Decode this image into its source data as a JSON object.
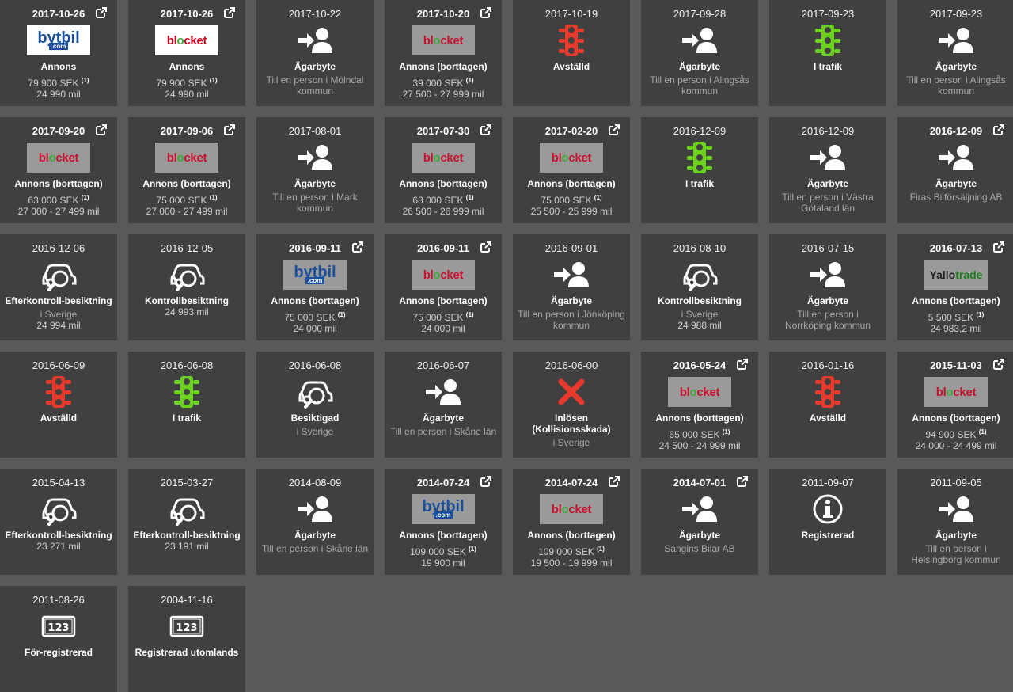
{
  "colors": {
    "page_bg": "#595959",
    "card_bg": "#404040",
    "red": "#e53a2c",
    "green": "#6bd320",
    "x_red": "#e53a2c"
  },
  "events": [
    {
      "date": "2017-10-26",
      "link": true,
      "icon": "bytbil-logo-white",
      "title": "Annons",
      "l1": "79 900 SEK",
      "sup": "(1)",
      "l2": "24 990 mil"
    },
    {
      "date": "2017-10-26",
      "link": true,
      "icon": "blocket-logo-white",
      "title": "Annons",
      "l1": "79 900 SEK",
      "sup": "(1)",
      "l2": "24 990 mil"
    },
    {
      "date": "2017-10-22",
      "link": false,
      "icon": "owner-change-icon",
      "title": "Ägarbyte",
      "sub": "Till en person i Mölndal kommun"
    },
    {
      "date": "2017-10-20",
      "link": true,
      "icon": "blocket-logo-grey",
      "title": "Annons (borttagen)",
      "l1": "39 000 SEK",
      "sup": "(1)",
      "l2": "27 500 - 27 999 mil"
    },
    {
      "date": "2017-10-19",
      "link": false,
      "icon": "traffic-light-red-icon",
      "title": "Avställd"
    },
    {
      "date": "2017-09-28",
      "link": false,
      "icon": "owner-change-icon",
      "title": "Ägarbyte",
      "sub": "Till en person i Alingsås kommun"
    },
    {
      "date": "2017-09-23",
      "link": false,
      "icon": "traffic-light-green-icon",
      "title": "I trafik"
    },
    {
      "date": "2017-09-23",
      "link": false,
      "icon": "owner-change-icon",
      "title": "Ägarbyte",
      "sub": "Till en person i Alingsås kommun"
    },
    {
      "date": "2017-09-20",
      "link": true,
      "icon": "blocket-logo-grey",
      "title": "Annons (borttagen)",
      "l1": "63 000 SEK",
      "sup": "(1)",
      "l2": "27 000 - 27 499 mil"
    },
    {
      "date": "2017-09-06",
      "link": true,
      "icon": "blocket-logo-grey",
      "title": "Annons (borttagen)",
      "l1": "75 000 SEK",
      "sup": "(1)",
      "l2": "27 000 - 27 499 mil"
    },
    {
      "date": "2017-08-01",
      "link": false,
      "icon": "owner-change-icon",
      "title": "Ägarbyte",
      "sub": "Till en person i Mark kommun"
    },
    {
      "date": "2017-07-30",
      "link": true,
      "icon": "blocket-logo-grey",
      "title": "Annons (borttagen)",
      "l1": "68 000 SEK",
      "sup": "(1)",
      "l2": "26 500 - 26 999 mil"
    },
    {
      "date": "2017-02-20",
      "link": true,
      "icon": "blocket-logo-grey",
      "title": "Annons (borttagen)",
      "l1": "75 000 SEK",
      "sup": "(1)",
      "l2": "25 500 - 25 999 mil"
    },
    {
      "date": "2016-12-09",
      "link": false,
      "icon": "traffic-light-green-icon",
      "title": "I trafik"
    },
    {
      "date": "2016-12-09",
      "link": false,
      "icon": "owner-change-icon",
      "title": "Ägarbyte",
      "sub": "Till en person i Västra Götaland län"
    },
    {
      "date": "2016-12-09",
      "link": true,
      "icon": "owner-change-icon",
      "title": "Ägarbyte",
      "sub": "Firas Bilförsäljning AB"
    },
    {
      "date": "2016-12-06",
      "link": false,
      "icon": "car-inspection-icon",
      "title": "Efterkontroll-besiktning",
      "sub": "i Sverige",
      "l2": "24 994 mil"
    },
    {
      "date": "2016-12-05",
      "link": false,
      "icon": "car-inspection-icon",
      "title": "Kontrollbesiktning",
      "l2": "24 993 mil"
    },
    {
      "date": "2016-09-11",
      "link": true,
      "icon": "bytbil-logo-grey",
      "title": "Annons (borttagen)",
      "l1": "75 000 SEK",
      "sup": "(1)",
      "l2": "24 000 mil"
    },
    {
      "date": "2016-09-11",
      "link": true,
      "icon": "blocket-logo-grey",
      "title": "Annons (borttagen)",
      "l1": "75 000 SEK",
      "sup": "(1)",
      "l2": "24 000 mil"
    },
    {
      "date": "2016-09-01",
      "link": false,
      "icon": "owner-change-icon",
      "title": "Ägarbyte",
      "sub": "Till en person i Jönköping kommun"
    },
    {
      "date": "2016-08-10",
      "link": false,
      "icon": "car-inspection-icon",
      "title": "Kontrollbesiktning",
      "sub": "i Sverige",
      "l2": "24 988 mil"
    },
    {
      "date": "2016-07-15",
      "link": false,
      "icon": "owner-change-icon",
      "title": "Ägarbyte",
      "sub": "Till en person i Norrköping kommun"
    },
    {
      "date": "2016-07-13",
      "link": true,
      "icon": "yallotrade-logo",
      "title": "Annons (borttagen)",
      "l1": "5 500 SEK",
      "sup": "(1)",
      "l2": "24 983,2 mil"
    },
    {
      "date": "2016-06-09",
      "link": false,
      "icon": "traffic-light-red-icon",
      "title": "Avställd"
    },
    {
      "date": "2016-06-08",
      "link": false,
      "icon": "traffic-light-green-icon",
      "title": "I trafik"
    },
    {
      "date": "2016-06-08",
      "link": false,
      "icon": "car-inspection-icon",
      "title": "Besiktigad",
      "sub": "i Sverige"
    },
    {
      "date": "2016-06-07",
      "link": false,
      "icon": "owner-change-icon",
      "title": "Ägarbyte",
      "sub": "Till en person i Skåne län"
    },
    {
      "date": "2016-06-00",
      "link": false,
      "icon": "x-icon",
      "title": "Inlösen (Kollisionsskada)",
      "sub": "i Sverige"
    },
    {
      "date": "2016-05-24",
      "link": true,
      "icon": "blocket-logo-grey",
      "title": "Annons (borttagen)",
      "l1": "65 000 SEK",
      "sup": "(1)",
      "l2": "24 500 - 24 999 mil"
    },
    {
      "date": "2016-01-16",
      "link": false,
      "icon": "traffic-light-red-icon",
      "title": "Avställd"
    },
    {
      "date": "2015-11-03",
      "link": true,
      "icon": "blocket-logo-grey",
      "title": "Annons (borttagen)",
      "l1": "94 900 SEK",
      "sup": "(1)",
      "l2": "24 000 - 24 499 mil"
    },
    {
      "date": "2015-04-13",
      "link": false,
      "icon": "car-inspection-icon",
      "title": "Efterkontroll-besiktning",
      "l2": "23 271 mil"
    },
    {
      "date": "2015-03-27",
      "link": false,
      "icon": "car-inspection-icon",
      "title": "Efterkontroll-besiktning",
      "l2": "23 191 mil"
    },
    {
      "date": "2014-08-09",
      "link": false,
      "icon": "owner-change-icon",
      "title": "Ägarbyte",
      "sub": "Till en person i Skåne län"
    },
    {
      "date": "2014-07-24",
      "link": true,
      "icon": "bytbil-logo-grey",
      "title": "Annons (borttagen)",
      "l1": "109 000 SEK",
      "sup": "(1)",
      "l2": "19 900 mil"
    },
    {
      "date": "2014-07-24",
      "link": true,
      "icon": "blocket-logo-grey",
      "title": "Annons (borttagen)",
      "l1": "109 000 SEK",
      "sup": "(1)",
      "l2": "19 500 - 19 999 mil"
    },
    {
      "date": "2014-07-01",
      "link": true,
      "icon": "owner-change-icon",
      "title": "Ägarbyte",
      "sub": "Sangins Bilar AB"
    },
    {
      "date": "2011-09-07",
      "link": false,
      "icon": "info-icon",
      "title": "Registrerad"
    },
    {
      "date": "2011-09-05",
      "link": false,
      "icon": "owner-change-icon",
      "title": "Ägarbyte",
      "sub": "Till en person i Helsingborg kommun"
    },
    {
      "date": "2011-08-26",
      "link": false,
      "icon": "plate-123-icon",
      "title": "För-registrerad"
    },
    {
      "date": "2004-11-16",
      "link": false,
      "icon": "plate-123-icon",
      "title": "Registrerad utomlands"
    }
  ],
  "logos": {
    "blocket": "blocket",
    "bytbil": "bytbil",
    "bytbil_com": ".com",
    "yallo_a": "Yallo",
    "yallo_b": "trade",
    "plate": "123"
  }
}
